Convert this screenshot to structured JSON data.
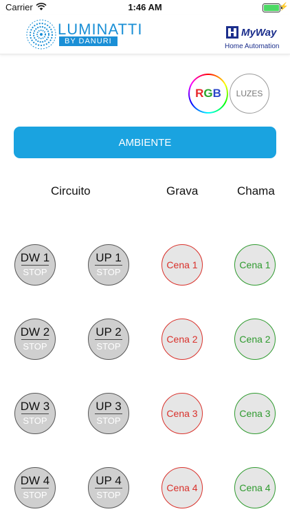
{
  "status_bar": {
    "carrier": "Carrier",
    "time": "1:46 AM"
  },
  "header": {
    "brand": "LUMINATTI",
    "brand_sub": "BY DANURI",
    "partner": "MyWay",
    "partner_sub": "Home Automation"
  },
  "buttons": {
    "rgb": [
      "R",
      "G",
      "B"
    ],
    "rgb_colors": [
      "#e8262a",
      "#2aa52a",
      "#2a45c9"
    ],
    "luzes": "LUZES",
    "ambiente": "AMBIENTE"
  },
  "columns": {
    "circuito": "Circuito",
    "grava": "Grava",
    "chama": "Chama"
  },
  "rows": [
    {
      "dw": "DW 1",
      "up": "UP 1",
      "stop": "STOP",
      "grava": "Cena 1",
      "chama": "Cena 1"
    },
    {
      "dw": "DW 2",
      "up": "UP 2",
      "stop": "STOP",
      "grava": "Cena 2",
      "chama": "Cena 2"
    },
    {
      "dw": "DW 3",
      "up": "UP 3",
      "stop": "STOP",
      "grava": "Cena 3",
      "chama": "Cena 3"
    },
    {
      "dw": "DW 4",
      "up": "UP 4",
      "stop": "STOP",
      "grava": "Cena 4",
      "chama": "Cena 4"
    }
  ]
}
